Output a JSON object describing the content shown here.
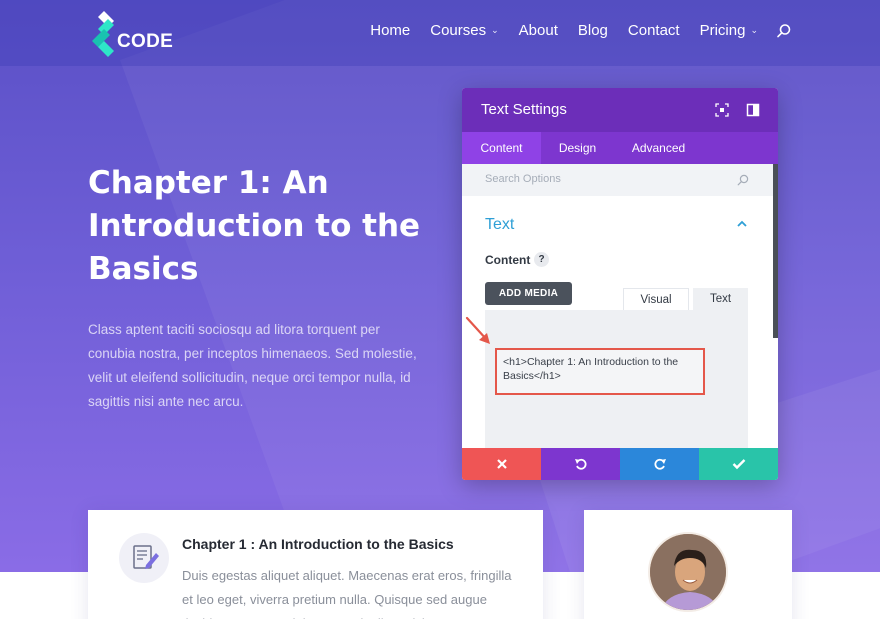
{
  "brand": {
    "logo_text": "CODE"
  },
  "nav": {
    "items": [
      {
        "label": "Home",
        "has_dropdown": false
      },
      {
        "label": "Courses",
        "has_dropdown": true
      },
      {
        "label": "About",
        "has_dropdown": false
      },
      {
        "label": "Blog",
        "has_dropdown": false
      },
      {
        "label": "Contact",
        "has_dropdown": false
      },
      {
        "label": "Pricing",
        "has_dropdown": true
      }
    ]
  },
  "hero": {
    "title": "Chapter 1: An Introduction to the Basics",
    "body": "Class aptent taciti sociosqu ad litora torquent per conubia nostra, per inceptos himenaeos. Sed molestie, velit ut eleifend sollicitudin, neque orci tempor nulla, id sagittis nisi ante nec arcu."
  },
  "modal": {
    "title": "Text Settings",
    "tabs": [
      "Content",
      "Design",
      "Advanced"
    ],
    "active_tab": "Content",
    "search_placeholder": "Search Options",
    "section_title": "Text",
    "content_label": "Content",
    "help": "?",
    "add_media_label": "ADD MEDIA",
    "editor_tabs": [
      "Visual",
      "Text"
    ],
    "editor_value": "<h1>Chapter 1: An Introduction to the Basics</h1>"
  },
  "cards": {
    "left": {
      "title": "Chapter 1 : An Introduction to the Basics",
      "body": "Duis egestas aliquet aliquet. Maecenas erat eros, fringilla et leo eget, viverra pretium nulla. Quisque sed augue tincidunt, posuere dui tempor, dapibus nisi."
    }
  },
  "colors": {
    "header_purple": "#6c2eb9",
    "tabs_purple": "#7d36cf",
    "accent_blue": "#2e9fd6",
    "cancel_red": "#ef5555",
    "redo_blue": "#2b87da",
    "save_green": "#29c4a9",
    "highlight_red": "#e4574a"
  },
  "icons": {
    "brand": "logo-mark-icon",
    "search": "search-icon",
    "fullscreen": "fullscreen-icon",
    "dock": "dock-sidebar-icon",
    "collapse": "chevron-up-icon",
    "cancel": "close-icon",
    "undo": "undo-icon",
    "redo": "redo-icon",
    "save": "check-icon",
    "card": "document-edit-icon",
    "annotation": "arrow-icon"
  }
}
